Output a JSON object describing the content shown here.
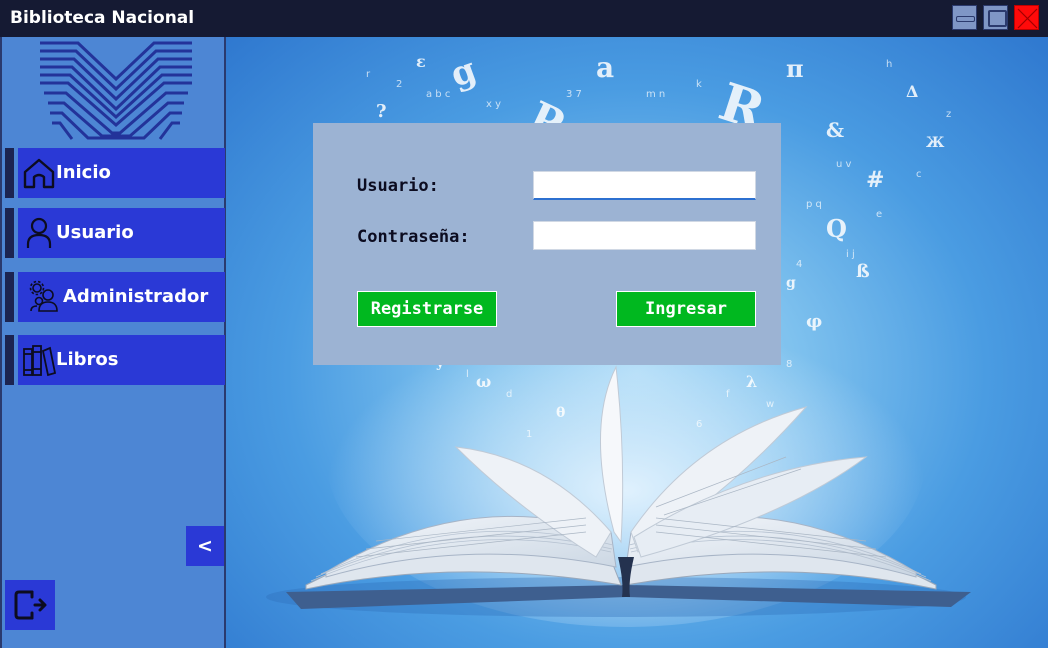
{
  "window": {
    "title": "Biblioteca Nacional",
    "controls": {
      "minimize": "minimize-icon",
      "maximize": "maximize-icon",
      "close": "close-icon"
    }
  },
  "sidebar": {
    "logo": "library-logo",
    "items": [
      {
        "label": "Inicio",
        "icon": "home-icon"
      },
      {
        "label": "Usuario",
        "icon": "user-icon"
      },
      {
        "label": "Administrador",
        "icon": "admin-icon"
      },
      {
        "label": "Libros",
        "icon": "books-icon"
      }
    ],
    "collapse_label": "<",
    "logout_icon": "logout-icon"
  },
  "login": {
    "user_label": "Usuario:",
    "user_value": "",
    "password_label": "Contraseña:",
    "password_value": "",
    "register_label": "Registrarse",
    "login_label": "Ingresar"
  },
  "colors": {
    "titlebar": "#151a33",
    "sidebar": "#4d86d4",
    "nav_button": "#2a39d6",
    "panel": "#9cb3d3",
    "action_button": "#00b81f",
    "close_button": "#ff0a0a"
  }
}
